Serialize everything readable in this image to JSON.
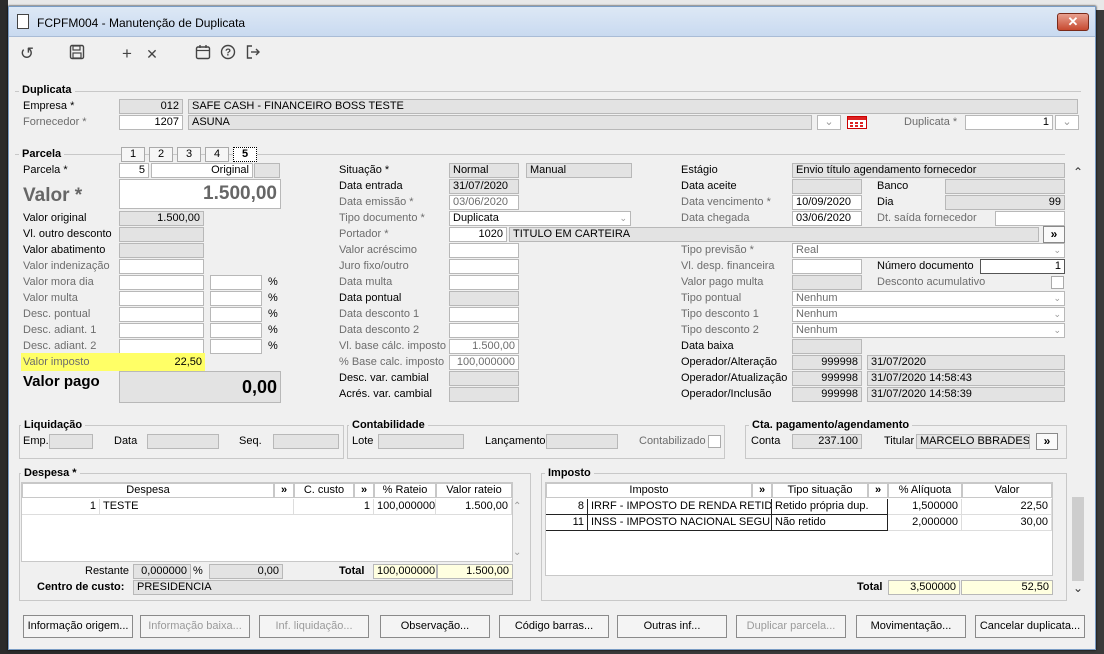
{
  "app": {
    "title": "FCPFM004 - Manutenção de Duplicata"
  },
  "colors": {
    "highlight": "#ffff66",
    "readonly": "#e3e3e3"
  },
  "toolbar": {
    "icons": [
      "refresh-icon",
      "save-icon",
      "add-icon",
      "delete-icon",
      "calendar-icon",
      "help-icon",
      "exit-icon"
    ],
    "add": "+",
    "del": "✕"
  },
  "duplicata": {
    "title": "Duplicata",
    "empresa_label": "Empresa *",
    "empresa_code": "012",
    "empresa_name": "SAFE CASH - FINANCEIRO BOSS TESTE",
    "fornecedor_label": "Fornecedor *",
    "fornecedor_code": "1207",
    "fornecedor_name": "ASUNA",
    "duplicata_label": "Duplicata *",
    "duplicata_value": "1"
  },
  "parcela": {
    "title": "Parcela",
    "tabs": [
      "1",
      "2",
      "3",
      "4",
      "5"
    ],
    "parcela_label": "Parcela *",
    "parcela_value": "5",
    "original": "Original",
    "valor_label": "Valor *",
    "valor_value": "1.500,00",
    "left_labels": [
      "Valor original",
      "Vl. outro desconto",
      "Valor abatimento",
      "Valor indenização",
      "Valor mora dia",
      "Valor multa",
      "Desc. pontual",
      "Desc. adiant. 1",
      "Desc. adiant. 2"
    ],
    "valor_original": "1.500,00",
    "pct": "%",
    "valor_imposto_label": "Valor imposto",
    "valor_imposto": "22,50",
    "valor_pago_label": "Valor pago",
    "valor_pago": "0,00"
  },
  "mid": {
    "situacao_label": "Situação *",
    "situacao1": "Normal",
    "situacao2": "Manual",
    "data_entrada_label": "Data entrada",
    "data_entrada": "31/07/2020",
    "data_emissao_label": "Data emissão *",
    "data_emissao": "03/06/2020",
    "tipo_doc_label": "Tipo documento *",
    "tipo_doc": "Duplicata",
    "portador_label": "Portador *",
    "portador_code": "1020",
    "portador_name": "TITULO EM CARTEIRA",
    "labels_b": [
      "Valor acréscimo",
      "Juro fixo/outro",
      "Data multa",
      "Data pontual",
      "Data desconto 1",
      "Data desconto 2"
    ],
    "vl_base_label": "Vl. base cálc. imposto",
    "vl_base": "1.500,00",
    "pct_base_label": "% Base calc. imposto",
    "pct_base": "100,000000",
    "desc_var_label": "Desc. var. cambial",
    "acres_var_label": "Acrés. var. cambial"
  },
  "right": {
    "estagio_label": "Estágio",
    "estagio": "Envio título agendamento fornecedor",
    "data_aceite_label": "Data aceite",
    "banco_label": "Banco",
    "data_venc_label": "Data vencimento *",
    "data_venc": "10/09/2020",
    "dia_label": "Dia",
    "dia": "99",
    "data_chegada_label": "Data chegada",
    "data_chegada": "03/06/2020",
    "dt_saida_label": "Dt. saída fornecedor",
    "tipo_prev_label": "Tipo previsão *",
    "tipo_prev": "Real",
    "vl_desp_label": "Vl. desp. financeira",
    "num_doc_label": "Número documento",
    "num_doc": "1",
    "valor_pago_multa_label": "Valor pago multa",
    "desc_acum_label": "Desconto acumulativo",
    "tipo_pontual_label": "Tipo pontual",
    "tipo_pontual": "Nenhum",
    "tipo_desc1_label": "Tipo desconto 1",
    "tipo_desc1": "Nenhum",
    "tipo_desc2_label": "Tipo desconto 2",
    "tipo_desc2": "Nenhum",
    "data_baixa_label": "Data baixa",
    "op_alt_label": "Operador/Alteração",
    "op_alt": "999998",
    "op_alt_date": "31/07/2020",
    "op_atu_label": "Operador/Atualização",
    "op_atu": "999998",
    "op_atu_date": "31/07/2020 14:58:43",
    "op_inc_label": "Operador/Inclusão",
    "op_inc": "999998",
    "op_inc_date": "31/07/2020 14:58:39"
  },
  "liquidacao": {
    "title": "Liquidação",
    "emp": "Emp.",
    "data": "Data",
    "seq": "Seq."
  },
  "contabilidade": {
    "title": "Contabilidade",
    "lote": "Lote",
    "lancamento": "Lançamento",
    "contabilizado": "Contabilizado"
  },
  "cta": {
    "title": "Cta. pagamento/agendamento",
    "conta_label": "Conta",
    "conta": "237.100",
    "titular_label": "Titular",
    "titular": "MARCELO  BBRADESC"
  },
  "despesa": {
    "title": "Despesa *",
    "headers": [
      "Despesa",
      "»",
      "C. custo",
      "»",
      "% Rateio",
      "Valor rateio"
    ],
    "row": {
      "num": "1",
      "name": "TESTE",
      "ccusto": "1",
      "rateio": "100,000000",
      "valor": "1.500,00"
    },
    "restante_label": "Restante",
    "restante_pct": "0,000000",
    "pct": "%",
    "restante_val": "0,00",
    "total_label": "Total",
    "total_pct": "100,000000",
    "total_val": "1.500,00",
    "centro_label": "Centro de custo:",
    "centro": "PRESIDENCIA"
  },
  "imposto": {
    "title": "Imposto",
    "headers": [
      "Imposto",
      "»",
      "Tipo situação",
      "»",
      "% Alíquota",
      "Valor"
    ],
    "rows": [
      {
        "num": "8",
        "name": "IRRF - IMPOSTO DE RENDA RETIDO N",
        "sit": "Retido própria dup.",
        "aliq": "1,500000",
        "valor": "22,50"
      },
      {
        "num": "11",
        "name": "INSS - IMPOSTO NACIONAL SEGURIE",
        "sit": "Não retido",
        "aliq": "2,000000",
        "valor": "30,00"
      }
    ],
    "total_label": "Total",
    "total_aliq": "3,500000",
    "total_val": "52,50"
  },
  "buttons": [
    "Informação origem...",
    "Informação baixa...",
    "Inf. liquidação...",
    "Observação...",
    "Código barras...",
    "Outras inf...",
    "Duplicar parcela...",
    "Movimentação...",
    "Cancelar duplicata..."
  ]
}
